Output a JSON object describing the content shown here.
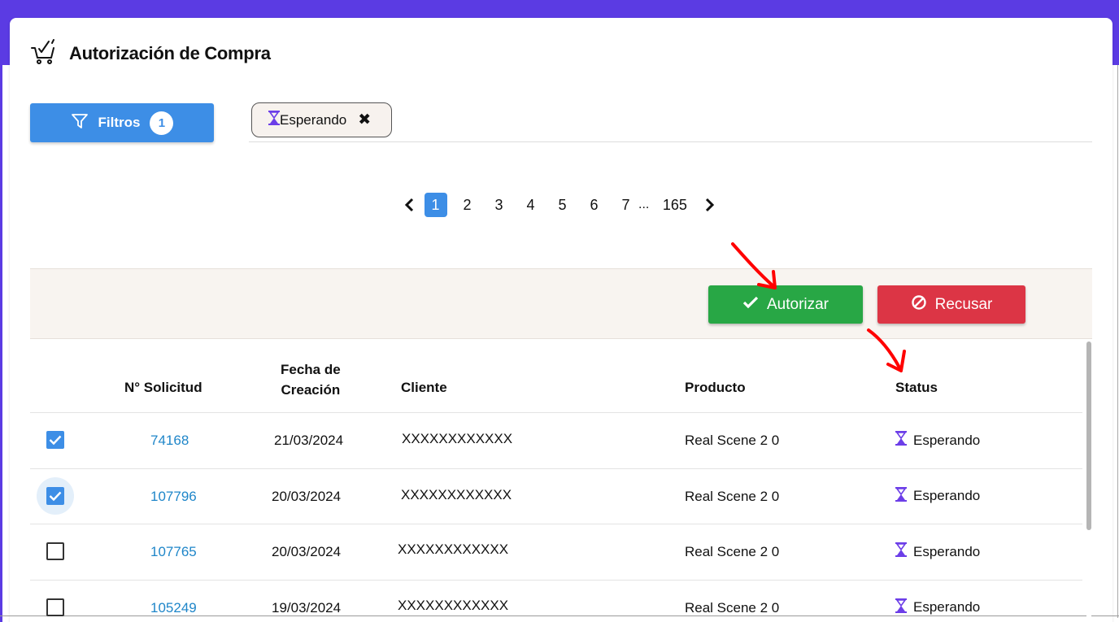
{
  "page": {
    "title": "Autorización de Compra",
    "title_icon": "cart-check-icon"
  },
  "filters": {
    "button_label": "Filtros",
    "count": "1",
    "chips": [
      {
        "label": "Esperando",
        "icon": "hourglass-icon",
        "remove_icon": "close-icon"
      }
    ]
  },
  "pagination": {
    "prev_icon": "chevron-left-icon",
    "next_icon": "chevron-right-icon",
    "pages": [
      "1",
      "2",
      "3",
      "4",
      "5",
      "6",
      "7"
    ],
    "current": "1",
    "ellipsis": "...",
    "last": "165"
  },
  "actions": {
    "authorize_label": "Autorizar",
    "authorize_icon": "check-icon",
    "reject_label": "Recusar",
    "reject_icon": "ban-icon"
  },
  "table": {
    "headers": {
      "numero": "N° Solicitud",
      "fecha_line1": "Fecha de",
      "fecha_line2": "Creación",
      "cliente": "Cliente",
      "producto": "Producto",
      "status": "Status"
    },
    "rows": [
      {
        "checked": true,
        "numero": "74168",
        "fecha": "21/03/2024",
        "cliente": "XXXXXXXXXXXX",
        "producto": "Real Scene 2 0",
        "status": "Esperando"
      },
      {
        "checked": true,
        "numero": "107796",
        "fecha": "20/03/2024",
        "cliente": "XXXXXXXXXXXX",
        "producto": "Real Scene 2 0",
        "status": "Esperando"
      },
      {
        "checked": false,
        "numero": "107765",
        "fecha": "20/03/2024",
        "cliente": "XXXXXXXXXXXX",
        "producto": "Real Scene 2 0",
        "status": "Esperando"
      },
      {
        "checked": false,
        "numero": "105249",
        "fecha": "19/03/2024",
        "cliente": "XXXXXXXXXXXX",
        "producto": "Real Scene 2 0",
        "status": "Esperando"
      }
    ]
  },
  "colors": {
    "brand_purple": "#5b3be3",
    "primary_blue": "#3d8ee6",
    "success_green": "#28a745",
    "danger_red": "#dc3545",
    "link_blue": "#1f86c9",
    "hourglass_purple": "#6c3ee8",
    "annotation_red": "#ff0000"
  }
}
